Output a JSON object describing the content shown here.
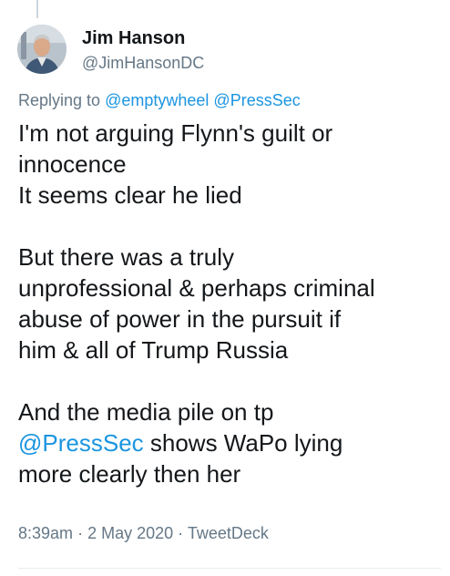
{
  "author": {
    "name": "Jim Hanson",
    "handle": "@JimHansonDC",
    "avatar_icon": "user-avatar-photo"
  },
  "reply": {
    "prefix": "Replying to",
    "mentions": [
      "@emptywheel",
      "@PressSec"
    ]
  },
  "tweet": {
    "lines": [
      "I'm not arguing Flynn's guilt or",
      "innocence",
      "It seems clear he lied",
      "",
      "But there was a truly",
      "unprofessional & perhaps criminal",
      "abuse of power in the pursuit if",
      "him & all of Trump Russia",
      "",
      "And the media pile on tp"
    ],
    "mention": "@PressSec",
    "mention_suffix": " shows WaPo lying",
    "last_line": "more clearly then her"
  },
  "meta": {
    "time": "8:39am",
    "date": "2 May 2020",
    "source": "TweetDeck",
    "separator": "·"
  },
  "colors": {
    "link": "#1b95e0",
    "secondary_text": "#657786",
    "primary_text": "#14171a"
  }
}
